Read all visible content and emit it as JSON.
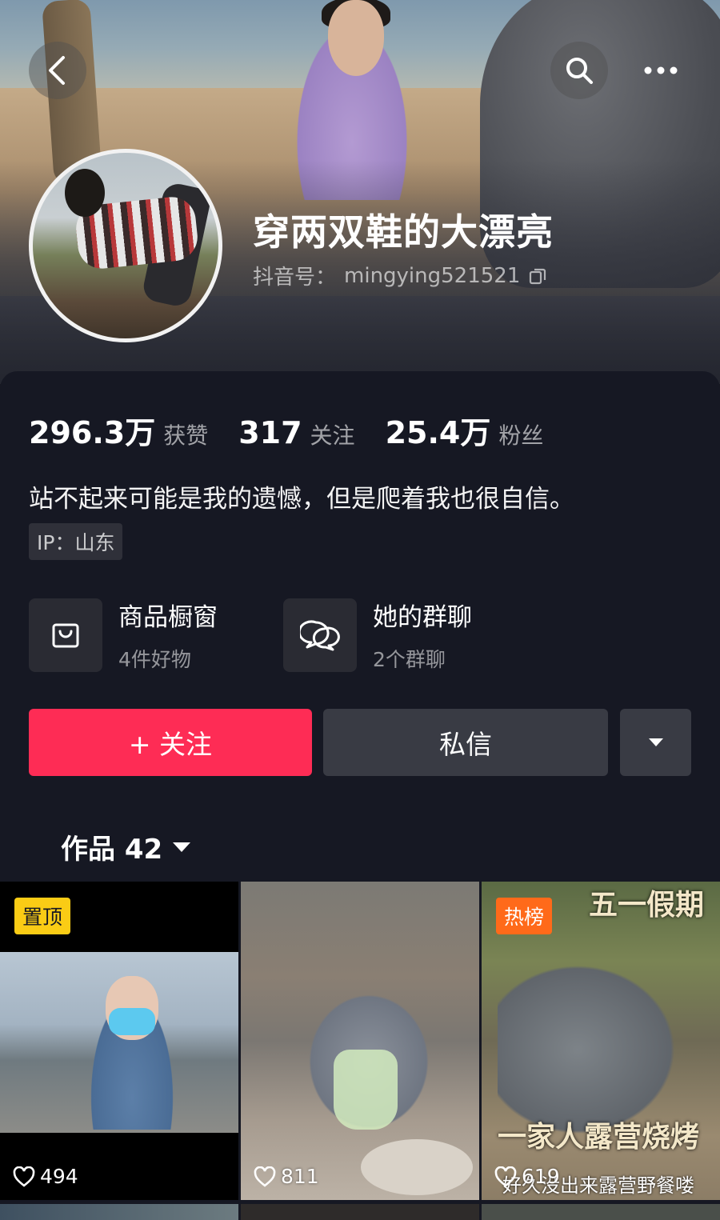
{
  "header": {
    "nickname": "穿两双鞋的大漂亮",
    "douyin_id_label": "抖音号：",
    "douyin_id": "mingying521521",
    "icons": [
      "back-icon",
      "search-icon",
      "more-icon",
      "copy-icon"
    ]
  },
  "stats": [
    {
      "value": "296.3万",
      "label": "获赞"
    },
    {
      "value": "317",
      "label": "关注"
    },
    {
      "value": "25.4万",
      "label": "粉丝"
    }
  ],
  "bio": "站不起来可能是我的遗憾，但是爬着我也很自信。",
  "ip": "IP：山东",
  "entries": {
    "shop": {
      "title": "商品橱窗",
      "sub": "4件好物",
      "icon": "shopping-bag-icon"
    },
    "chat": {
      "title": "她的群聊",
      "sub": "2个群聊",
      "icon": "group-chat-icon"
    }
  },
  "actions": {
    "follow": "+ 关注",
    "message": "私信",
    "dropdown_icon": "caret-down-icon"
  },
  "works_tab": "作品 42",
  "videos": [
    {
      "badge": "置顶",
      "likes": "494"
    },
    {
      "badge": "",
      "likes": "811"
    },
    {
      "badge": "热榜",
      "likes": "619",
      "overlay_title": "五一假期",
      "overlay_sub": "一家人露营烧烤",
      "caption": "好久没出来露营野餐喽"
    }
  ],
  "colors": {
    "background": "#161823",
    "follow_button": "#fe2c55",
    "secondary_button": "#393b44",
    "pin_badge": "#facc15",
    "hot_badge": "#ff6a1a"
  }
}
